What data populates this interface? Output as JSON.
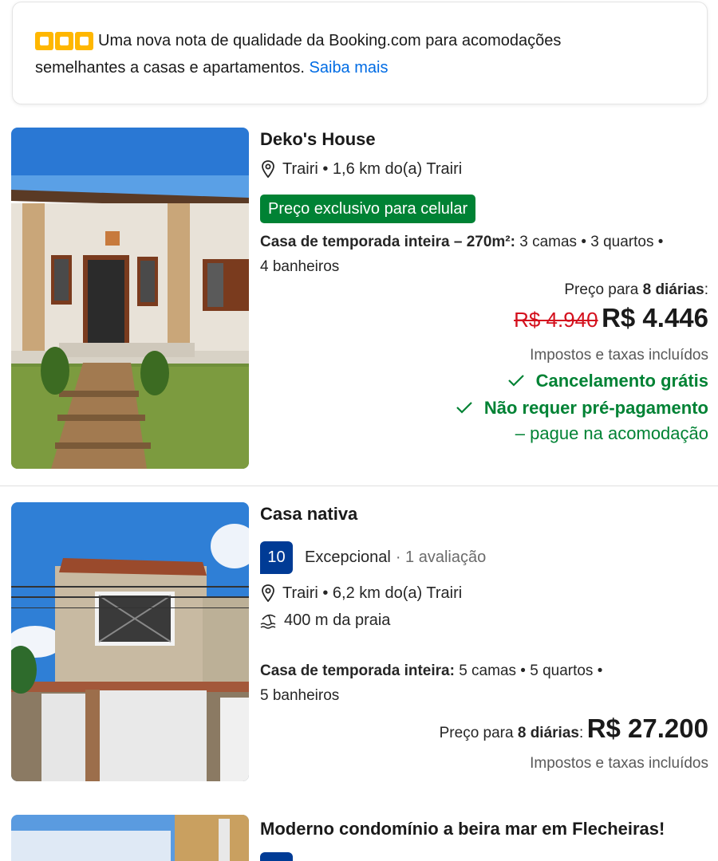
{
  "notice": {
    "text_line1": "Uma nova nota de qualidade da Booking.com para acomodações",
    "text_line2": "semelhantes a casas e apartamentos.",
    "link": "Saiba mais"
  },
  "listings": [
    {
      "title": "Deko's House",
      "location": "Trairi • 1,6 km do(a) Trairi",
      "badge": "Preço exclusivo para celular",
      "desc_bold": "Casa de temporada inteira – 270m²:",
      "desc_rest": " 3 camas • 3 quartos •",
      "desc_line2": "4 banheiros",
      "price_label": "Preço para ",
      "price_nights": "8 diárias",
      "price_colon": ":",
      "price_old": "R$ 4.940",
      "price_new": "R$ 4.446",
      "taxes": "Impostos e taxas incluídos",
      "cancel": "Cancelamento grátis",
      "prepay": "Não requer pré-pagamento",
      "pay_at": "– pague na acomodação"
    },
    {
      "title": "Casa nativa",
      "score": "10",
      "score_label": "Excepcional",
      "reviews": "· 1 avaliação",
      "location": "Trairi • 6,2 km do(a) Trairi",
      "beach": "400 m da praia",
      "desc_bold": "Casa de temporada inteira:",
      "desc_rest": " 5 camas • 5 quartos •",
      "desc_line2": "5 banheiros",
      "price_label": "Preço para ",
      "price_nights": "8 diárias",
      "price_colon": ":",
      "price_new": "R$ 27.200",
      "taxes": "Impostos e taxas incluídos"
    },
    {
      "title": "Moderno condomínio a beira mar em Flecheiras!"
    }
  ],
  "colors": {
    "brand_blue": "#003b95",
    "link_blue": "#006ce4",
    "green": "#008234",
    "red_strike": "#d4111e",
    "star_yellow": "#ffb700"
  }
}
